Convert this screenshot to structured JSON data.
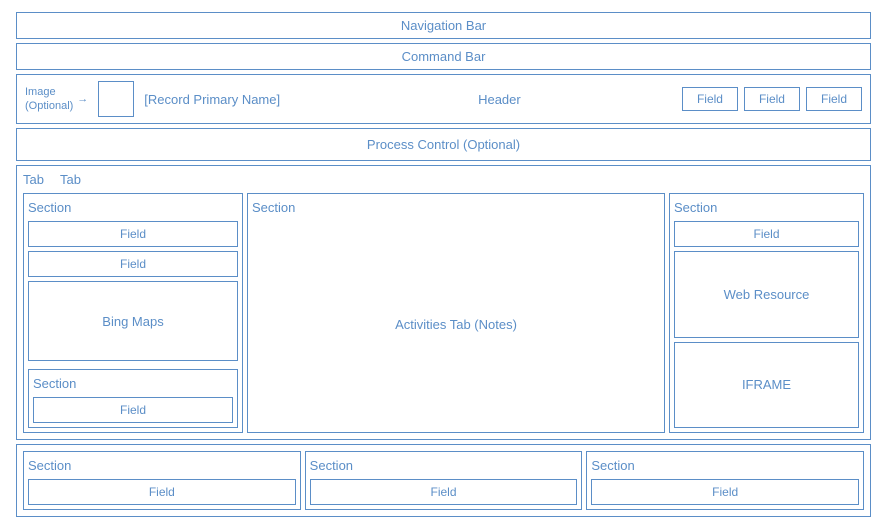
{
  "bars": {
    "navigation": "Navigation Bar",
    "command": "Command Bar"
  },
  "header": {
    "image_label": "Image\n(Optional)",
    "record_name": "[Record Primary Name]",
    "center": "Header",
    "fields": [
      "Field",
      "Field",
      "Field"
    ]
  },
  "process": {
    "label": "Process Control (Optional)"
  },
  "tabs": {
    "tab1": "Tab",
    "tab2": "Tab"
  },
  "columns": {
    "left": {
      "section_label": "Section",
      "field1": "Field",
      "field2": "Field",
      "bing_maps": "Bing Maps",
      "sub_section_label": "Section",
      "sub_field": "Field"
    },
    "mid": {
      "section_label": "Section",
      "activities": "Activities Tab (Notes)"
    },
    "right": {
      "section_label": "Section",
      "field1": "Field",
      "web_resource": "Web Resource",
      "iframe": "IFRAME"
    }
  },
  "bottom": {
    "col1": {
      "section_label": "Section",
      "field": "Field"
    },
    "col2": {
      "section_label": "Section",
      "field": "Field"
    },
    "col3": {
      "section_label": "Section",
      "field": "Field"
    }
  }
}
